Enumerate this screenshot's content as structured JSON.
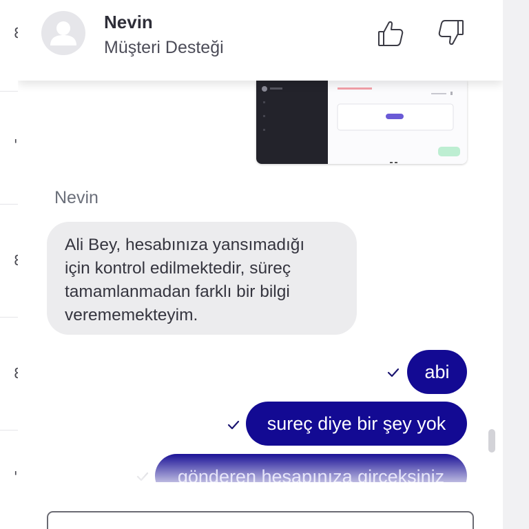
{
  "background": {
    "left_fragments": [
      "8",
      "'",
      "8",
      "8",
      "'"
    ]
  },
  "header": {
    "agent_name": "Nevin",
    "agent_role": "Müşteri Desteği",
    "thumbs_up_icon": "thumbs-up-icon",
    "thumbs_down_icon": "thumbs-down-icon"
  },
  "messages": {
    "incoming_sender": "Nevin",
    "incoming_lines": [
      "Ali Bey, hesabınıza yansımadığı",
      "için kontrol edilmektedir, süreç",
      "tamamlanmadan farklı bir bilgi",
      "verememekteyim."
    ],
    "outgoing": [
      {
        "text": "abi",
        "status": "sent"
      },
      {
        "text": "sureç diye bir şey yok",
        "status": "sent"
      },
      {
        "text": "gönderen hesapınıza girceksiniz",
        "status": "sending"
      }
    ]
  },
  "composer": {
    "placeholder": ""
  },
  "colors": {
    "outgoing_bubble": "#130a93",
    "incoming_bubble": "#ececee",
    "tick": "#1a1470"
  }
}
